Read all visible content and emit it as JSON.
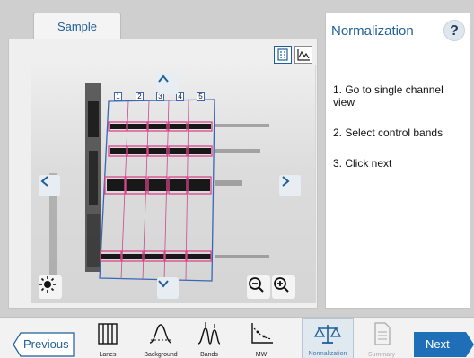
{
  "left_panel": {
    "tab_label": "Sample",
    "view_buttons": [
      "image-view-icon",
      "graph-view-icon"
    ],
    "lane_labels": [
      "1",
      "2",
      "3",
      "4",
      "5"
    ],
    "controls": [
      "arrow-up-icon",
      "arrow-down-icon",
      "arrow-left-icon",
      "arrow-right-icon",
      "brightness-icon",
      "zoom-out-icon",
      "zoom-in-icon"
    ]
  },
  "right_panel": {
    "title": "Normalization",
    "help_label": "?",
    "steps": [
      "1. Go to single channel view",
      "2. Select control bands",
      "3. Click next"
    ]
  },
  "toolbar": {
    "previous_label": "Previous",
    "next_label": "Next",
    "tools": [
      {
        "label": "Lanes",
        "icon": "lanes-icon"
      },
      {
        "label": "Background",
        "icon": "background-icon"
      },
      {
        "label": "Bands",
        "icon": "bands-icon"
      },
      {
        "label": "MW",
        "icon": "mw-icon"
      },
      {
        "label": "Normalization",
        "icon": "scale-icon"
      },
      {
        "label": "Summary",
        "icon": "document-icon"
      }
    ]
  },
  "colors": {
    "accent": "#1f5f99",
    "next_button": "#1f6fb8",
    "lane_frame": "#3a66b8",
    "band_highlight": "#d9468c"
  }
}
